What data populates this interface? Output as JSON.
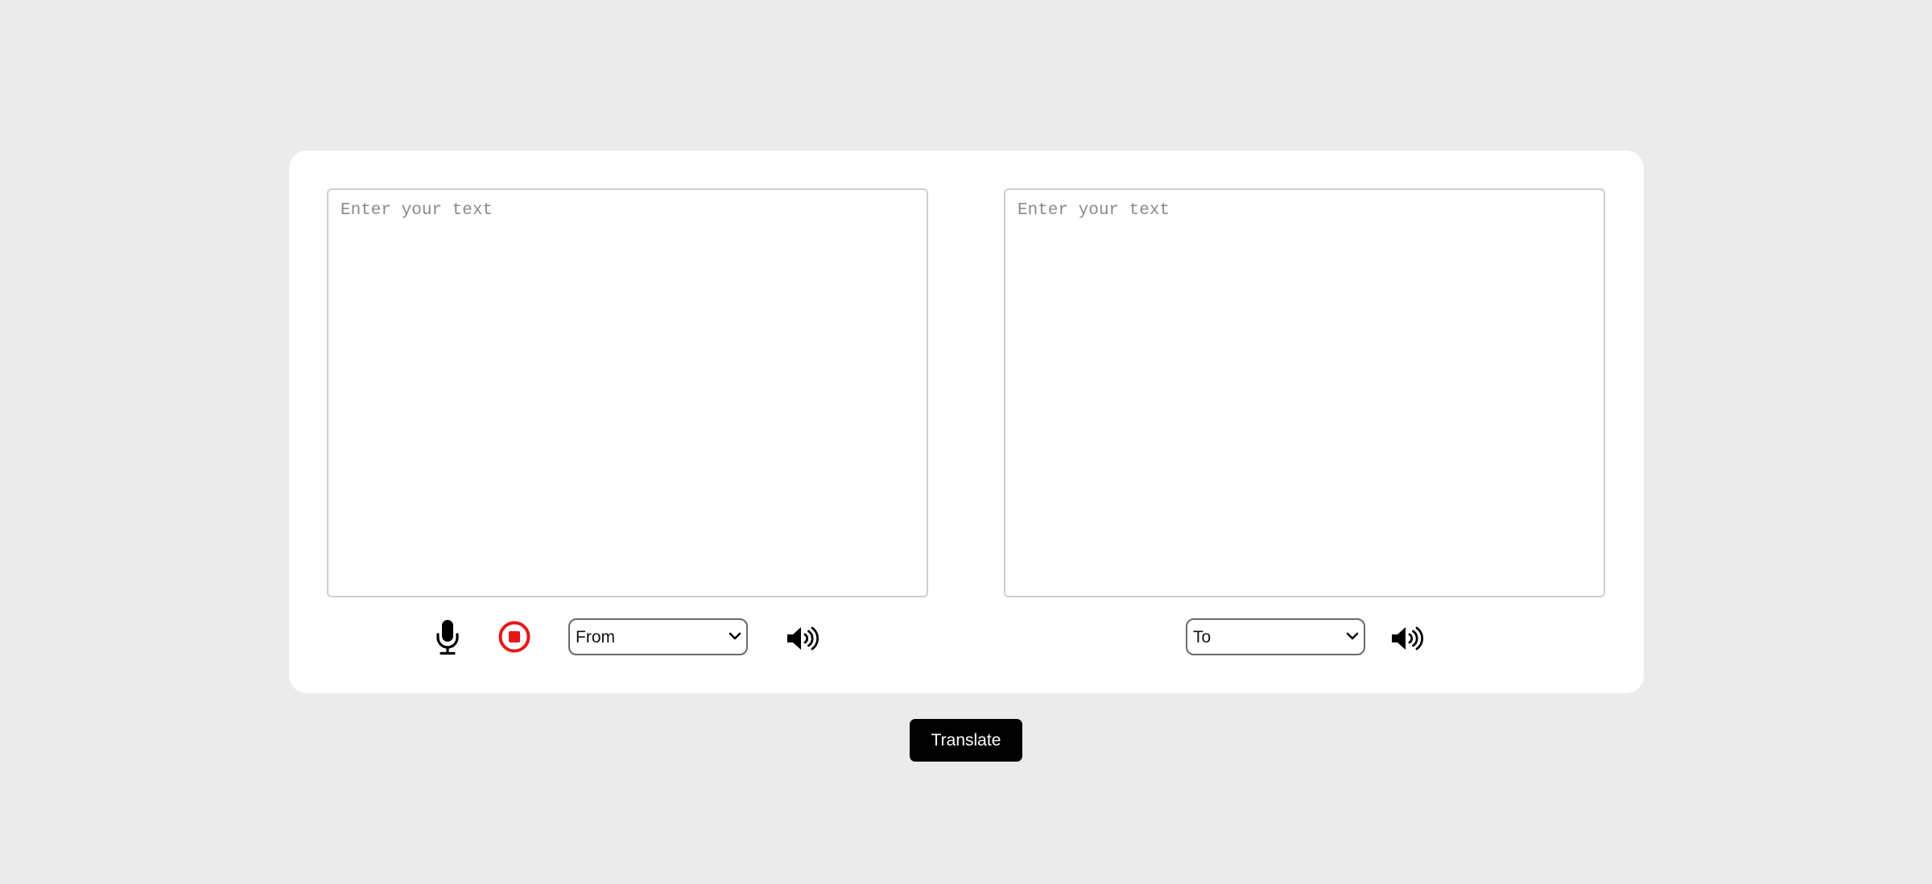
{
  "source": {
    "placeholder": "Enter your text",
    "language_select": {
      "selected": "From"
    },
    "icons": {
      "mic": "microphone-icon",
      "stop": "stop-record-icon",
      "speaker": "speaker-icon"
    }
  },
  "target": {
    "placeholder": "Enter your text",
    "language_select": {
      "selected": "To"
    },
    "icons": {
      "speaker": "speaker-icon"
    }
  },
  "translate_button": {
    "label": "Translate"
  },
  "colors": {
    "background": "#ebebeb",
    "card": "#ffffff",
    "stop_red": "#e8161a",
    "button": "#000000"
  }
}
